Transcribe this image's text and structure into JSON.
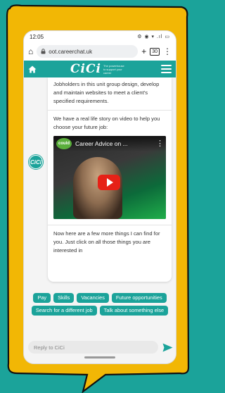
{
  "status_bar": {
    "time": "12:05",
    "icons": "⚙ ◉ ▾ .ıl ▭"
  },
  "browser": {
    "url": "oot.careerchat.uk",
    "tab_count": "30"
  },
  "site": {
    "logo": "CiCi",
    "tagline": "The powerhouse to support your career"
  },
  "chat": {
    "avatar_text": "CiCi",
    "message_1": "Jobholders in this unit group design, develop and maintain websites to meet a client's specified requirements.",
    "message_2": "We have a real life story on video to help you choose your future job:",
    "video": {
      "channel": "could",
      "title": "Career Advice on ..."
    },
    "message_3": "Now here are a few more things I can find for you. Just click on all those things you are interested in"
  },
  "quick_replies": [
    "Pay",
    "Skills",
    "Vacancies",
    "Future opportunities",
    "Search for a different job",
    "Talk about something else"
  ],
  "reply": {
    "placeholder": "Reply to CiCi"
  },
  "colors": {
    "brand_teal": "#1ba39a",
    "border_yellow": "#f2b705",
    "play_red": "#e62117"
  }
}
